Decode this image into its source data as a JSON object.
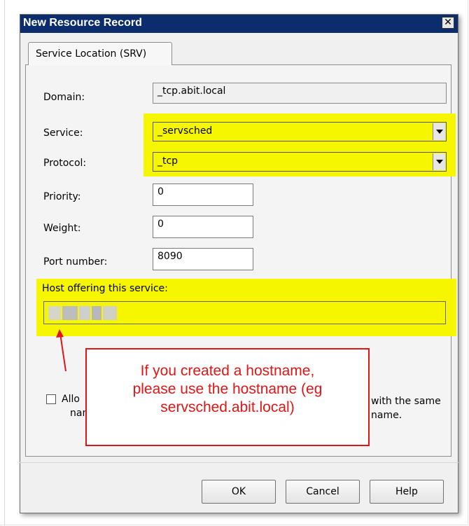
{
  "window": {
    "title": "New Resource Record",
    "close_glyph": "✕"
  },
  "tab": {
    "label": "Service Location (SRV)"
  },
  "fields": {
    "domain": {
      "label": "Domain:",
      "value": "_tcp.abit.local"
    },
    "service": {
      "label": "Service:",
      "value": "_servsched"
    },
    "protocol": {
      "label": "Protocol:",
      "value": "_tcp"
    },
    "priority": {
      "label": "Priority:",
      "value": "0"
    },
    "weight": {
      "label": "Weight:",
      "value": "0"
    },
    "port": {
      "label": "Port number:",
      "value": "8090"
    },
    "host": {
      "label": "Host offering this service:",
      "value": ""
    }
  },
  "checkbox": {
    "checked": false,
    "label_line1_left": "Allo",
    "label_line1_right": "with the same",
    "label_line2_left": "nam",
    "label_line2_right": "name."
  },
  "callout": {
    "line1": "If you created a hostname,",
    "line2": "please use the hostname (eg",
    "line3": "servsched.abit.local)"
  },
  "buttons": {
    "ok": "OK",
    "cancel": "Cancel",
    "help": "Help"
  },
  "colors": {
    "highlight": "#f6f600",
    "callout_red": "#e01616",
    "titlebar": "#0b2d6e"
  }
}
